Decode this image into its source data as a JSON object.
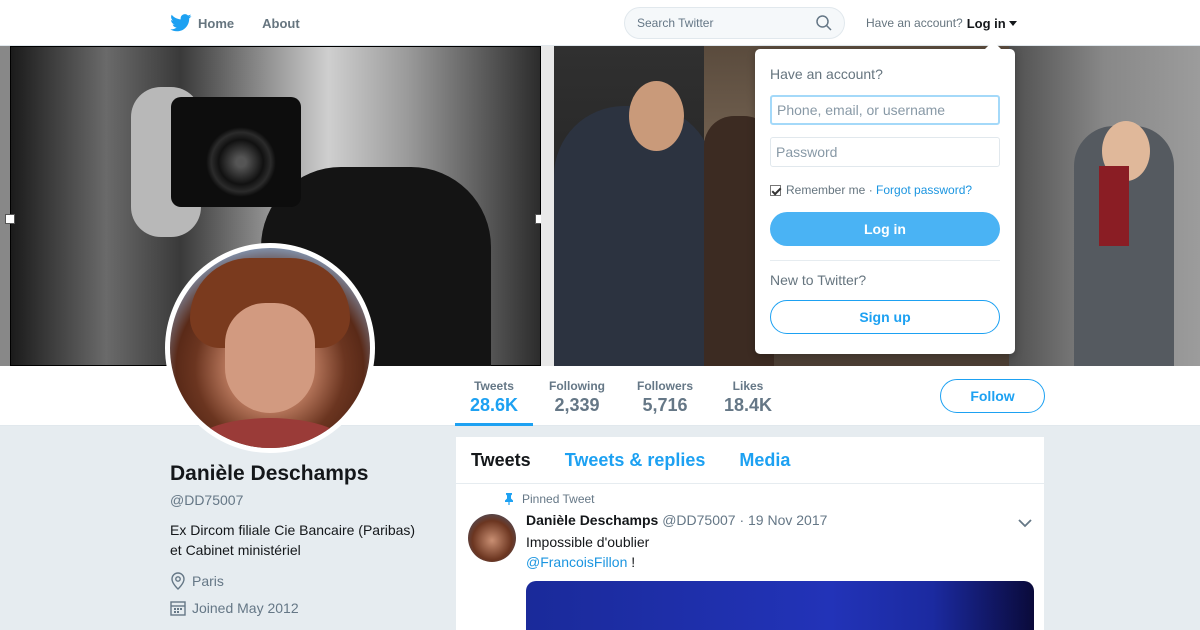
{
  "nav": {
    "home_label": "Home",
    "about_label": "About",
    "search_placeholder": "Search Twitter",
    "account_prompt": "Have an account?",
    "login_label": "Log in"
  },
  "profile": {
    "name": "Danièle Deschamps",
    "handle": "@DD75007",
    "bio_line1": "Ex Dircom filiale Cie Bancaire (Paribas)",
    "bio_line2": "et Cabinet ministériel",
    "location": "Paris",
    "joined": "Joined May 2012"
  },
  "stats": [
    {
      "label": "Tweets",
      "value": "28.6K"
    },
    {
      "label": "Following",
      "value": "2,339"
    },
    {
      "label": "Followers",
      "value": "5,716"
    },
    {
      "label": "Likes",
      "value": "18.4K"
    }
  ],
  "follow_label": "Follow",
  "timeline": {
    "tabs": [
      "Tweets",
      "Tweets & replies",
      "Media"
    ],
    "pinned_label": "Pinned Tweet",
    "tweet": {
      "author": "Danièle Deschamps",
      "handle": "@DD75007",
      "date": "· 19 Nov 2017",
      "text": "Impossible d'oublier",
      "mention": "@FrancoisFillon",
      "suffix": " !"
    }
  },
  "login_dropdown": {
    "title": "Have an account?",
    "username_placeholder": "Phone, email, or username",
    "password_placeholder": "Password",
    "remember_label": "Remember me ·",
    "forgot_label": "Forgot password?",
    "login_button": "Log in",
    "new_prompt": "New to Twitter?",
    "signup_button": "Sign up"
  },
  "colors": {
    "brand": "#1da1f2",
    "background": "#e6ecf0",
    "text_secondary": "#657786"
  }
}
